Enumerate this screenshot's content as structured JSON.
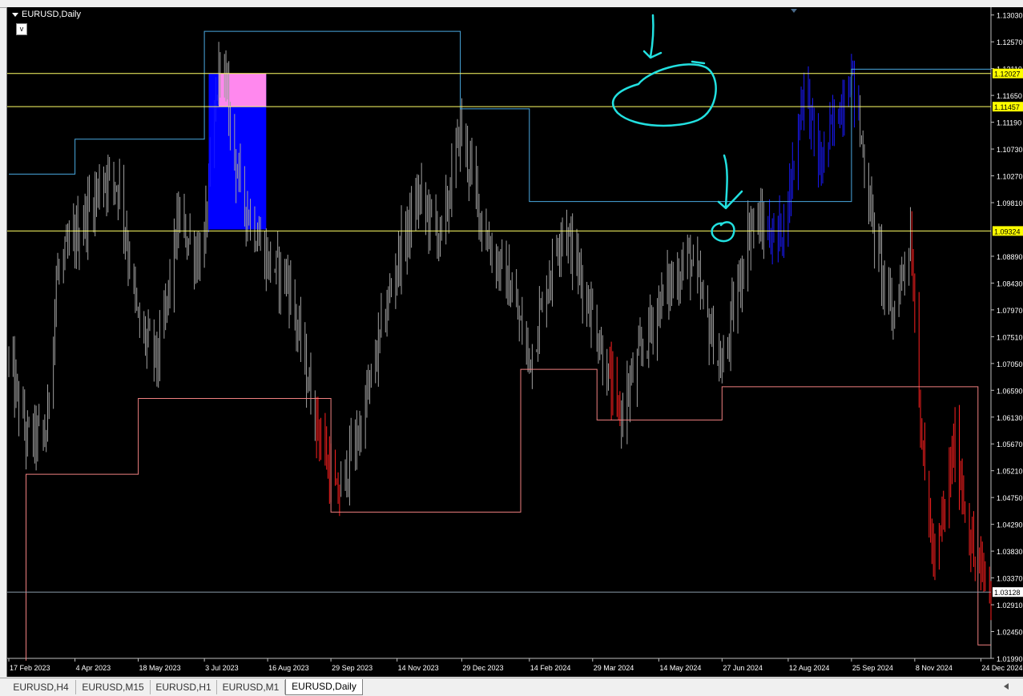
{
  "window": {
    "title": "EURUSD,Daily",
    "v_button": "v"
  },
  "price_axis": {
    "labels": [
      "1.13030",
      "1.12570",
      "1.12110",
      "1.11650",
      "1.11190",
      "1.10730",
      "1.10270",
      "1.09810",
      "1.08890",
      "1.08430",
      "1.07970",
      "1.07510",
      "1.07050",
      "1.06590",
      "1.06130",
      "1.05670",
      "1.05210",
      "1.04750",
      "1.04290",
      "1.03830",
      "1.03370",
      "1.02910",
      "1.02450",
      "1.01990"
    ],
    "highlight": [
      {
        "value": "1.12027",
        "kind": "yellow"
      },
      {
        "value": "1.11457",
        "kind": "yellow"
      },
      {
        "value": "1.09324",
        "kind": "yellow"
      },
      {
        "value": "1.03128",
        "kind": "white"
      }
    ]
  },
  "date_axis": {
    "labels": [
      "17 Feb 2023",
      "4 Apr 2023",
      "18 May 2023",
      "3 Jul 2023",
      "16 Aug 2023",
      "29 Sep 2023",
      "14 Nov 2023",
      "29 Dec 2023",
      "14 Feb 2024",
      "29 Mar 2024",
      "14 May 2024",
      "27 Jun 2024",
      "12 Aug 2024",
      "25 Sep 2024",
      "8 Nov 2024",
      "24 Dec 2024"
    ]
  },
  "tabs": [
    {
      "label": "EURUSD,H4",
      "active": false
    },
    {
      "label": "EURUSD,M15",
      "active": false
    },
    {
      "label": "EURUSD,H1",
      "active": false
    },
    {
      "label": "EURUSD,M1",
      "active": false
    },
    {
      "label": "EURUSD,Daily",
      "active": true
    }
  ],
  "colors": {
    "background": "#000000",
    "bars": "#a0a0a0",
    "bull_bars": "#1a1aff",
    "bear_bars": "#ff2020",
    "upper_step": "#4aa8e0",
    "lower_step": "#f08080",
    "level_line": "#ffff66",
    "annotation": "#22e0e0",
    "zone_blue": "#0000ff",
    "zone_pink": "#ff88ee"
  },
  "chart_data": {
    "type": "candlestick",
    "symbol": "EURUSD",
    "timeframe": "Daily",
    "ylim": [
      1.0199,
      1.1315
    ],
    "x_range": [
      "2023-02-17",
      "2024-12-31"
    ],
    "close_path": [
      [
        "2023-02-17",
        1.071
      ],
      [
        "2023-03-01",
        1.058
      ],
      [
        "2023-03-15",
        1.058
      ],
      [
        "2023-03-22",
        1.085
      ],
      [
        "2023-04-04",
        1.092
      ],
      [
        "2023-04-25",
        1.103
      ],
      [
        "2023-05-05",
        1.101
      ],
      [
        "2023-05-18",
        1.077
      ],
      [
        "2023-06-01",
        1.071
      ],
      [
        "2023-06-15",
        1.095
      ],
      [
        "2023-06-28",
        1.089
      ],
      [
        "2023-07-03",
        1.091
      ],
      [
        "2023-07-14",
        1.124
      ],
      [
        "2023-07-28",
        1.1
      ],
      [
        "2023-08-16",
        1.088
      ],
      [
        "2023-08-30",
        1.085
      ],
      [
        "2023-09-15",
        1.065
      ],
      [
        "2023-10-03",
        1.047
      ],
      [
        "2023-10-20",
        1.06
      ],
      [
        "2023-11-14",
        1.088
      ],
      [
        "2023-11-29",
        1.099
      ],
      [
        "2023-12-15",
        1.092
      ],
      [
        "2023-12-28",
        1.111
      ],
      [
        "2024-01-15",
        1.092
      ],
      [
        "2024-02-01",
        1.083
      ],
      [
        "2024-02-14",
        1.071
      ],
      [
        "2024-03-08",
        1.095
      ],
      [
        "2024-03-29",
        1.079
      ],
      [
        "2024-04-16",
        1.061
      ],
      [
        "2024-05-14",
        1.081
      ],
      [
        "2024-06-04",
        1.089
      ],
      [
        "2024-06-27",
        1.069
      ],
      [
        "2024-07-17",
        1.095
      ],
      [
        "2024-08-05",
        1.092
      ],
      [
        "2024-08-12",
        1.098
      ],
      [
        "2024-08-23",
        1.119
      ],
      [
        "2024-09-03",
        1.104
      ],
      [
        "2024-09-25",
        1.121
      ],
      [
        "2024-10-10",
        1.094
      ],
      [
        "2024-10-23",
        1.078
      ],
      [
        "2024-11-05",
        1.093
      ],
      [
        "2024-11-14",
        1.053
      ],
      [
        "2024-11-22",
        1.035
      ],
      [
        "2024-12-06",
        1.057
      ],
      [
        "2024-12-19",
        1.037
      ],
      [
        "2024-12-31",
        1.031
      ]
    ],
    "colored_segments": [
      {
        "color": "bull",
        "from": "2023-07-06",
        "to": "2023-07-12"
      },
      {
        "color": "bear",
        "from": "2023-09-19",
        "to": "2023-10-05"
      },
      {
        "color": "bear",
        "from": "2024-04-10",
        "to": "2024-04-17"
      },
      {
        "color": "bull",
        "from": "2024-07-29",
        "to": "2024-09-30"
      },
      {
        "color": "bear",
        "from": "2024-11-06",
        "to": "2024-12-31"
      }
    ],
    "levels": [
      1.12027,
      1.11457,
      1.09324
    ],
    "current_price": 1.03128,
    "upper_step": [
      [
        "2023-02-17",
        1.103
      ],
      [
        "2023-04-04",
        1.103
      ],
      [
        "2023-04-04",
        1.109
      ],
      [
        "2023-07-03",
        1.109
      ],
      [
        "2023-07-03",
        1.1275
      ],
      [
        "2023-12-28",
        1.1275
      ],
      [
        "2023-12-28",
        1.1142
      ],
      [
        "2024-02-14",
        1.1142
      ],
      [
        "2024-02-14",
        1.0983
      ],
      [
        "2024-09-25",
        1.0983
      ],
      [
        "2024-09-25",
        1.121
      ],
      [
        "2024-12-31",
        1.121
      ]
    ],
    "lower_step": [
      [
        "2023-03-01",
        1.0195
      ],
      [
        "2023-03-01",
        1.0515
      ],
      [
        "2023-05-18",
        1.0515
      ],
      [
        "2023-05-18",
        1.0645
      ],
      [
        "2023-09-29",
        1.0645
      ],
      [
        "2023-09-29",
        1.045
      ],
      [
        "2024-02-08",
        1.045
      ],
      [
        "2024-02-08",
        1.0695
      ],
      [
        "2024-04-01",
        1.0695
      ],
      [
        "2024-04-01",
        1.0608
      ],
      [
        "2024-06-27",
        1.0608
      ],
      [
        "2024-06-27",
        1.0665
      ],
      [
        "2024-12-22",
        1.0665
      ],
      [
        "2024-12-22",
        1.0222
      ],
      [
        "2024-12-31",
        1.0222
      ]
    ],
    "zones": [
      {
        "from": "2023-07-06",
        "to": "2023-08-15",
        "top": 1.12027,
        "bottom": 1.0935,
        "color": "zone_blue"
      },
      {
        "from": "2023-07-13",
        "to": "2023-08-15",
        "top": 1.12027,
        "bottom": 1.11457,
        "color": "zone_pink"
      }
    ]
  }
}
